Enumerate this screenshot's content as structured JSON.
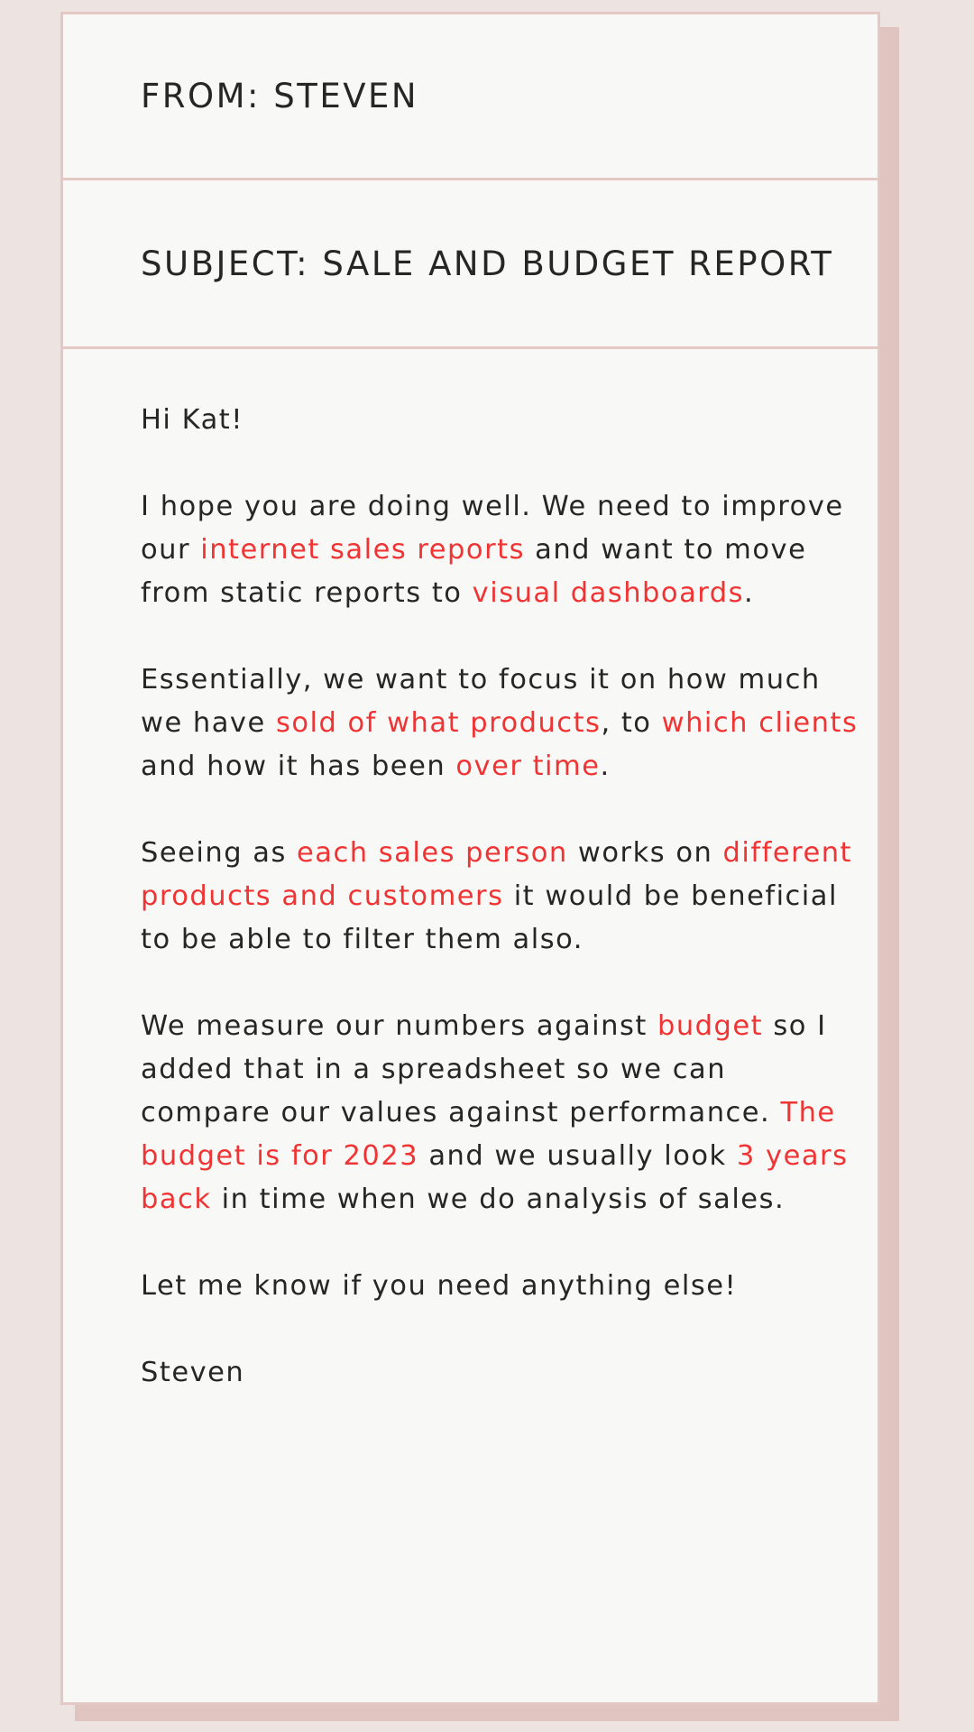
{
  "email": {
    "from_line": "FROM: STEVEN",
    "subject_line": "SUBJECT: SALE AND BUDGET REPORT",
    "greeting": "Hi Kat!",
    "paragraph_1": {
      "t1": "I hope you are doing well. We need to improve our ",
      "h1": "internet sales reports",
      "t2": " and want to move from static reports to ",
      "h2": "visual dashboards",
      "t3": "."
    },
    "paragraph_2": {
      "t1": "Essentially, we want to focus it on how much we have ",
      "h1": "sold of what products",
      "t2": ", to ",
      "h2": "which clients",
      "t3": " and how it has been ",
      "h3": "over time",
      "t4": "."
    },
    "paragraph_3": {
      "t1": "Seeing as ",
      "h1": "each sales person",
      "t2": " works on ",
      "h2": "different products and customers",
      "t3": " it would be beneficial to be able to filter them also."
    },
    "paragraph_4": {
      "t1": "We measure our numbers against ",
      "h1": "budget",
      "t2": " so I added that in a spreadsheet so we can compare our values against performance. ",
      "h2": "The budget is for 2023",
      "t3": " and we usually look ",
      "h3": "3 years back",
      "t4": " in time when we do analysis of sales."
    },
    "closing": "Let me know if you need anything else!",
    "signature": "Steven"
  },
  "colors": {
    "background": "#ede3e1",
    "card": "#f8f8f6",
    "border": "#e3c8c4",
    "shadow": "#dfc4bf",
    "highlight": "#f03434",
    "text": "#262626"
  }
}
